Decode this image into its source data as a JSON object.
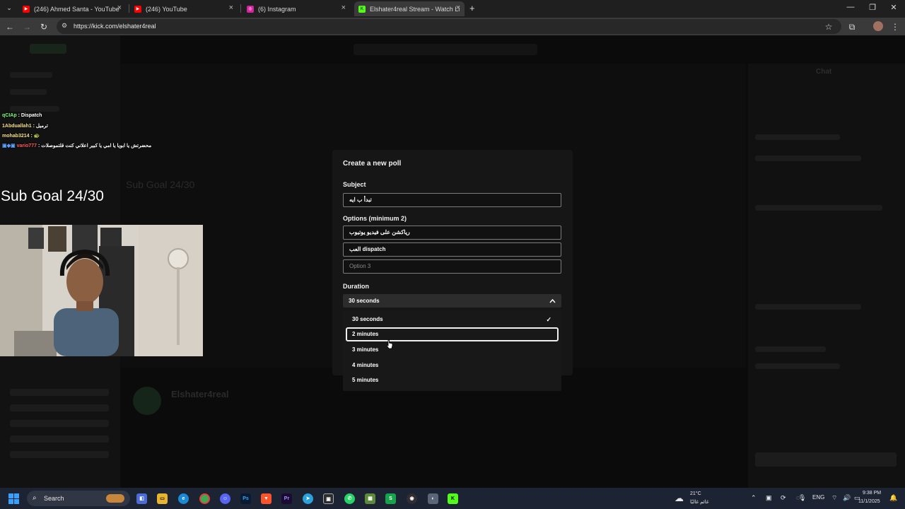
{
  "browser": {
    "tabs": [
      {
        "title": "(246) Ahmed Santa - YouTube",
        "color": "#ff0000",
        "glyph": "▶"
      },
      {
        "title": "(246) YouTube",
        "color": "#ff0000",
        "glyph": "▶"
      },
      {
        "title": "(6) Instagram",
        "color": "#d6249f",
        "glyph": "◎"
      },
      {
        "title": "Elshater4real Stream - Watch Li",
        "color": "#53fc18",
        "glyph": "K"
      }
    ],
    "url": "https://kick.com/elshater4real"
  },
  "overlay": {
    "chat": [
      {
        "user": "qCIAp",
        "msg": ": Dispatch",
        "color": "#7cfc7c"
      },
      {
        "user": "1Abduallah1",
        "msg": ": ترميل",
        "color": "#f5e08a"
      },
      {
        "user": "mohab3214",
        "msg": ": 🐢",
        "color": "#f5e08a"
      },
      {
        "user": "vario777",
        "msg": ": محضرتش يا ابويا يا امي يا كبير اعلاني كنت قلتموصلات",
        "color": "#ff5a5a"
      }
    ],
    "sub_goal": "Sub Goal 24/30"
  },
  "background_ghosts": {
    "sub_goal_text": "Sub Goal 24/30",
    "streamer": "Elshater4real",
    "chat_title": "Chat"
  },
  "poll": {
    "title": "Create a new poll",
    "subject_label": "Subject",
    "subject_value": "تبدأ ب ايه",
    "options_label": "Options (minimum 2)",
    "option1_value": "رياكشن على فيديو يوتيوب",
    "option2_value": "العب dispatch",
    "option3_placeholder": "Option 3",
    "duration_label": "Duration",
    "duration_selected": "30 seconds",
    "duration_options": [
      "30 seconds",
      "2 minutes",
      "3 minutes",
      "4 minutes",
      "5 minutes"
    ],
    "checked_option": "30 seconds",
    "hovered_option": "2 minutes"
  },
  "taskbar": {
    "search_label": "Search",
    "weather_temp": "21°C",
    "weather_desc": "غائم غالبًا",
    "lang": "ENG",
    "time": "9:38 PM",
    "date": "11/1/2025"
  }
}
